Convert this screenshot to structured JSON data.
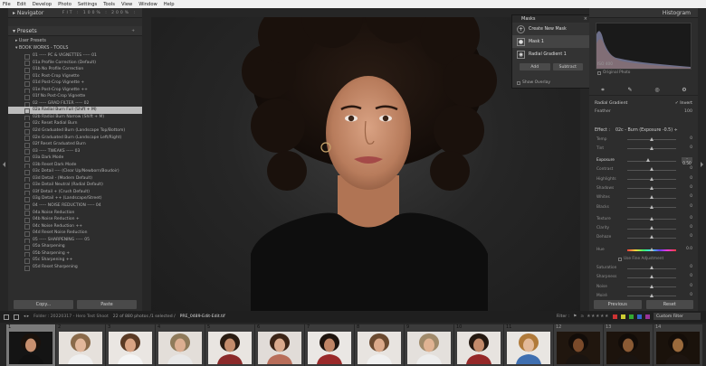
{
  "menu": [
    "File",
    "Edit",
    "Develop",
    "Photo",
    "Settings",
    "Tools",
    "View",
    "Window",
    "Help"
  ],
  "navigator": {
    "title": "Navigator",
    "zoom": "FIT  :  100%  :  200%  :"
  },
  "presets": {
    "title": "Presets",
    "groups": [
      "User Presets",
      "BOOK WORKS - TOOLS"
    ],
    "items": [
      "01 ----- PC & VIGNETTES ----- 01",
      "01a Profile Correction (Default)",
      "01b No Profile Correction",
      "01c Post-Crop Vignette",
      "01d Post-Crop Vignette +",
      "01e Post-Crop Vignette ++",
      "01f No Post-Crop Vignette",
      "02 ----- GRAD FILTER ----- 02",
      "02a Radial Burn Full (Shift + M)",
      "02b Radial Burn Narrow (Shift + M)",
      "02c Reset Radial Burn",
      "02d Graduated Burn (Landscape Top/Bottom)",
      "02e Graduated Burn (Landscape Left/Right)",
      "02f Reset Graduated Burn",
      "03 ----- TWEAKS ----- 03",
      "03a Dark Mode",
      "03b Reset Dark Mode",
      "03c Detail ---- (Clear Up/Newborn/Boudoir)",
      "03d Detail - (Modern Default)",
      "03e Detail Neutral (Radial Default)",
      "03f Detail + (Crush Default)",
      "03g Detail ++ (Landscape/Street)",
      "04 ----- NOISE REDUCTION ----- 04",
      "04a Noise Reduction",
      "04b Noise Reduction +",
      "04c Noise Reduction ++",
      "04d Reset Noise Reduction",
      "05 ----- SHARPENING ----- 05",
      "05a Sharpening",
      "05b Sharpening +",
      "05c Sharpening ++",
      "05d Reset Sharpening"
    ],
    "selected_index": 8
  },
  "left_buttons": {
    "copy": "Copy...",
    "paste": "Paste"
  },
  "masks": {
    "title": "Masks",
    "create": "Create New Mask",
    "mask_name": "Mask 1",
    "component": "Radial Gradient 1",
    "add": "Add",
    "subtract": "Subtract",
    "show_overlay": "Show Overlay"
  },
  "histogram": {
    "title": "Histogram",
    "readout": "ISO 400",
    "original_photo": "Original Photo"
  },
  "mask_settings": {
    "type": "Radial Gradient",
    "invert": "Invert",
    "feather_label": "Feather",
    "feather_value": "100",
    "effect_label": "Effect :",
    "effect_value": "02c - Burn (Exposure -0.5) ÷"
  },
  "sliders": [
    {
      "label": "Temp",
      "value": "0",
      "pos": 0.5
    },
    {
      "label": "Tint",
      "value": "0",
      "pos": 0.5
    },
    {
      "label": "Exposure",
      "value": "- 0.50",
      "pos": 0.44,
      "boxed": true,
      "lit": true
    },
    {
      "label": "Contrast",
      "value": "0",
      "pos": 0.5
    },
    {
      "label": "Highlights",
      "value": "0",
      "pos": 0.5
    },
    {
      "label": "Shadows",
      "value": "0",
      "pos": 0.5
    },
    {
      "label": "Whites",
      "value": "0",
      "pos": 0.5
    },
    {
      "label": "Blacks",
      "value": "0",
      "pos": 0.5
    },
    {
      "label": "Texture",
      "value": "0",
      "pos": 0.5
    },
    {
      "label": "Clarity",
      "value": "0",
      "pos": 0.5
    },
    {
      "label": "Dehaze",
      "value": "0",
      "pos": 0.5
    },
    {
      "label": "Hue",
      "value": "0.0",
      "pos": 0.5,
      "hue": true
    },
    {
      "label": "Saturation",
      "value": "0",
      "pos": 0.5
    },
    {
      "label": "Sharpness",
      "value": "0",
      "pos": 0.5
    },
    {
      "label": "Noise",
      "value": "0",
      "pos": 0.5
    },
    {
      "label": "Moiré",
      "value": "0",
      "pos": 0.5
    },
    {
      "label": "Defringe",
      "value": "0",
      "pos": 0.5
    }
  ],
  "use_fine": "Use Fine Adjustment",
  "right_buttons": {
    "previous": "Previous",
    "reset": "Reset"
  },
  "filmbar": {
    "folder": "Folder : 20220317 - Hero Test Shoot",
    "count": "22 of 880 photos /1 selected /",
    "selected_file": "PRE_0489-Edit-Edit.tif",
    "filter": "Filter :",
    "custom_filter": "Custom Filter"
  },
  "filmstrip": [
    {
      "num": "1",
      "bg": "#141414",
      "skin": "#c8906f",
      "hair": "#1a120c",
      "shirt": "#111111",
      "active": true
    },
    {
      "num": "2",
      "bg": "#e6e1dc",
      "skin": "#e2b79b",
      "hair": "#8a6a4a",
      "shirt": "#efefef"
    },
    {
      "num": "3",
      "bg": "#eae6e2",
      "skin": "#d9a383",
      "hair": "#5a3a24",
      "shirt": "#f4f4f4"
    },
    {
      "num": "4",
      "bg": "#e3ded9",
      "skin": "#dcae91",
      "hair": "#8f7a5a",
      "shirt": "#e8e8e8"
    },
    {
      "num": "5",
      "bg": "#e9e5e1",
      "skin": "#c48c6c",
      "hair": "#2a1c12",
      "shirt": "#8b2a2a"
    },
    {
      "num": "6",
      "bg": "#e1dcd8",
      "skin": "#d9a98c",
      "hair": "#3b2416",
      "shirt": "#b86e5a"
    },
    {
      "num": "7",
      "bg": "#eae7e4",
      "skin": "#c08566",
      "hair": "#1e140e",
      "shirt": "#9a2a2a"
    },
    {
      "num": "8",
      "bg": "#e8e4e0",
      "skin": "#dba98a",
      "hair": "#6b4a30",
      "shirt": "#f0f0f0"
    },
    {
      "num": "9",
      "bg": "#e4e0dc",
      "skin": "#e0b393",
      "hair": "#a08a6a",
      "shirt": "#ededed"
    },
    {
      "num": "10",
      "bg": "#e7e3df",
      "skin": "#c38a6a",
      "hair": "#241810",
      "shirt": "#952828"
    },
    {
      "num": "11",
      "bg": "#e9e6e2",
      "skin": "#e3b998",
      "hair": "#b07a3a",
      "shirt": "#3f6fb0"
    },
    {
      "num": "12",
      "bg": "#20160e",
      "skin": "#7a4a2a",
      "hair": "#120c08",
      "shirt": "#1a1410",
      "dark": true
    },
    {
      "num": "13",
      "bg": "#1c130c",
      "skin": "#8a5a34",
      "hair": "#120c08",
      "shirt": "#1a1410",
      "dark": true
    },
    {
      "num": "14",
      "bg": "#1a120b",
      "skin": "#9a6a3c",
      "hair": "#140d08",
      "shirt": "#1d1510",
      "dark": true
    }
  ]
}
